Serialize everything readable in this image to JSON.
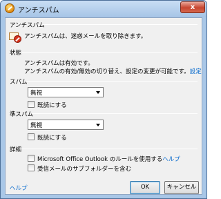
{
  "window": {
    "title": "アンチスパム",
    "close_label": "x"
  },
  "header": {
    "section": "アンチスパム",
    "description": "アンチスパムは、迷惑メールを取り除きます。"
  },
  "status": {
    "section": "状態",
    "line1": "アンチスパムは有効です。",
    "line2": "アンチスパムの有効/無効の切り替え、設定の変更が可能です。",
    "settings_link": "設定"
  },
  "spam": {
    "section": "スパム",
    "select_value": "無視",
    "mark_read_label": "既読にする"
  },
  "semi_spam": {
    "section": "準スパム",
    "select_value": "無視",
    "mark_read_label": "既読にする"
  },
  "details": {
    "section": "詳細",
    "outlook_rules_label": "Microsoft Office Outlook のルールを使用する",
    "help_link": "ヘルプ",
    "subfolders_label": "受信メールのサブフォルダーを含む"
  },
  "footer": {
    "help_link": "ヘルプ",
    "ok_label": "OK",
    "cancel_label": "キャンセル"
  },
  "icons": {
    "title": "antispam-icon",
    "app": "antispam-envelope-icon",
    "dropdown": "chevron-down-icon"
  }
}
